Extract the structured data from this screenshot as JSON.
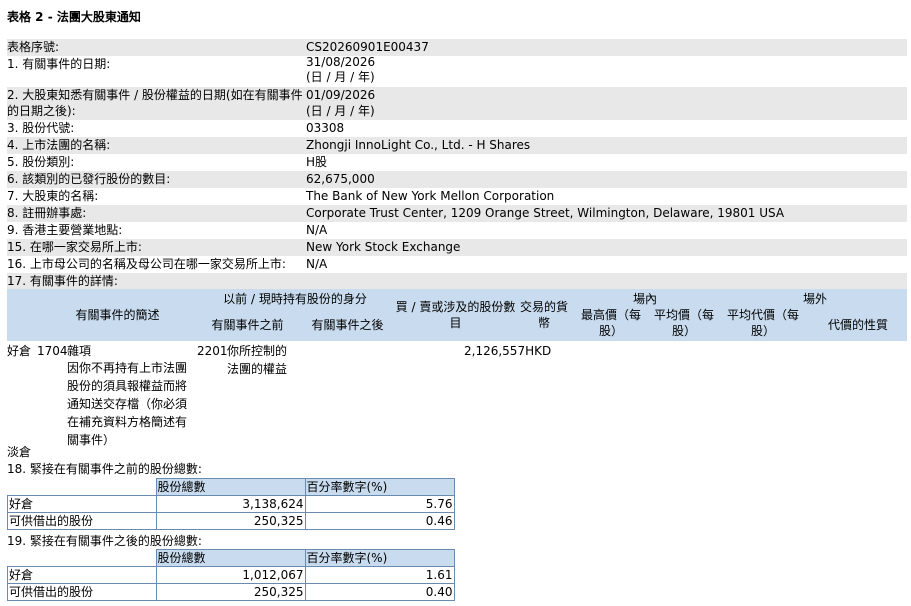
{
  "title": "表格 2 - 法團大股東通知",
  "fields": [
    {
      "label": "表格序號:",
      "value": "CS20260901E00437"
    },
    {
      "label": "1. 有關事件的日期:",
      "value": "31/08/2026",
      "note": "(日 / 月 / 年)"
    },
    {
      "label": "2. 大股東知悉有關事件 / 股份權益的日期(如在有關事件",
      "label2": "的日期之後):",
      "value": "01/09/2026",
      "note": "(日 / 月 / 年)"
    },
    {
      "label": "3. 股份代號:",
      "value": "03308"
    },
    {
      "label": "4. 上市法團的名稱:",
      "value": "Zhongji InnoLight Co., Ltd. - H Shares"
    },
    {
      "label": "5. 股份類別:",
      "value": "H股"
    },
    {
      "label": "6. 該類別的已發行股份的數目:",
      "value": "62,675,000"
    },
    {
      "label": "7. 大股東的名稱:",
      "value": "The Bank of New York Mellon Corporation"
    },
    {
      "label": "8. 註冊辦事處:",
      "value": "Corporate Trust Center, 1209 Orange Street, Wilmington, Delaware, 19801 USA"
    },
    {
      "label": "9. 香港主要營業地點:",
      "value": "N/A"
    },
    {
      "label": "15. 在哪一家交易所上市:",
      "value": "New York Stock Exchange"
    },
    {
      "label": "16. 上市母公司的名稱及母公司在哪一家交易所上市:",
      "value": "N/A"
    },
    {
      "label": "17. 有關事件的詳情:",
      "value": ""
    }
  ],
  "event_table": {
    "headers": {
      "event_desc": "有關事件的簡述",
      "capacity": "以前 / 現時持有股份的身分",
      "before": "有關事件之前",
      "after": "有關事件之後",
      "shares": "買 / 賣或涉及的股份數目",
      "currency": "交易的貨幣",
      "on_exchange": "場內",
      "highest": "最高價（每股）",
      "average": "平均價（每股）",
      "off_exchange": "場外",
      "avg_consideration": "平均代價（每股）",
      "nature": "代價的性質"
    },
    "row": {
      "position": "好倉",
      "code": "1704",
      "desc": "雜項",
      "desc_detail": "因你不再持有上市法團股份的須具報權益而將通知送交存檔（你必須在補充資料方格簡述有關事件）",
      "cap_code": "2201",
      "cap_desc": "你所控制的法團的權益",
      "shares": "2,126,557",
      "currency": "HKD"
    },
    "short_label": "淡倉"
  },
  "section18": {
    "title": "18. 緊接在有關事件之前的股份總數:",
    "col_shares": "股份總數",
    "col_pct": "百分率數字(%)",
    "rows": [
      {
        "label": "好倉",
        "shares": "3,138,624",
        "pct": "5.76"
      },
      {
        "label": "可供借出的股份",
        "shares": "250,325",
        "pct": "0.46"
      }
    ]
  },
  "section19": {
    "title": "19. 緊接在有關事件之後的股份總數:",
    "col_shares": "股份總數",
    "col_pct": "百分率數字(%)",
    "rows": [
      {
        "label": "好倉",
        "shares": "1,012,067",
        "pct": "1.61"
      },
      {
        "label": "可供借出的股份",
        "shares": "250,325",
        "pct": "0.40"
      }
    ]
  }
}
